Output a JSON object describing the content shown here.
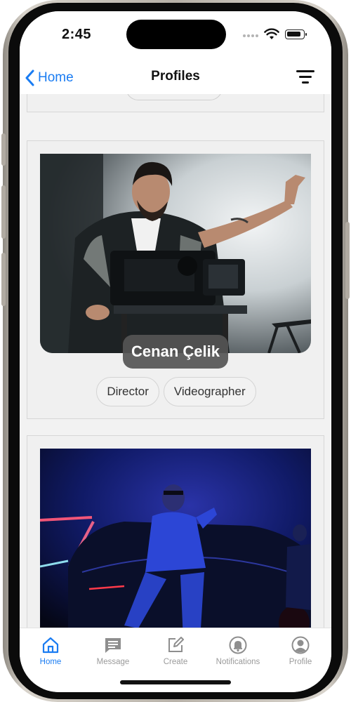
{
  "status_bar": {
    "time": "2:45"
  },
  "nav": {
    "back_label": "Home",
    "title": "Profiles"
  },
  "profiles": [
    {
      "name": "Cenan Çelik",
      "tags": [
        "Director",
        "Videographer"
      ]
    }
  ],
  "tab_bar": {
    "items": [
      {
        "label": "Home",
        "icon": "home-icon",
        "active": true
      },
      {
        "label": "Message",
        "icon": "message-icon",
        "active": false
      },
      {
        "label": "Create",
        "icon": "create-icon",
        "active": false
      },
      {
        "label": "Notifications",
        "icon": "bell-icon",
        "active": false
      },
      {
        "label": "Profile",
        "icon": "profile-icon",
        "active": false
      }
    ]
  },
  "colors": {
    "accent": "#1a7cf2",
    "inactive": "#9a9a9a",
    "badge": "#555555"
  }
}
